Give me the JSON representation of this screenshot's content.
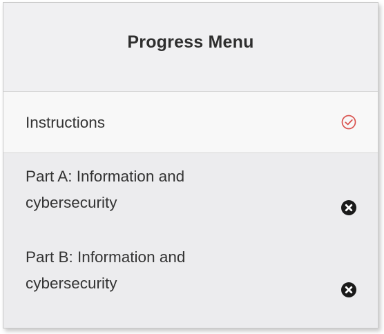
{
  "progress_menu": {
    "title": "Progress Menu",
    "items": [
      {
        "label": "Instructions",
        "status": "complete",
        "icon": "check-circle-icon",
        "status_color": "#d9534f"
      },
      {
        "label": "Part A: Information and cybersecurity",
        "status": "incomplete",
        "icon": "times-circle-icon",
        "status_color": "#1a1a1a"
      },
      {
        "label": "Part B: Information and cybersecurity",
        "status": "incomplete",
        "icon": "times-circle-icon",
        "status_color": "#1a1a1a"
      }
    ]
  }
}
